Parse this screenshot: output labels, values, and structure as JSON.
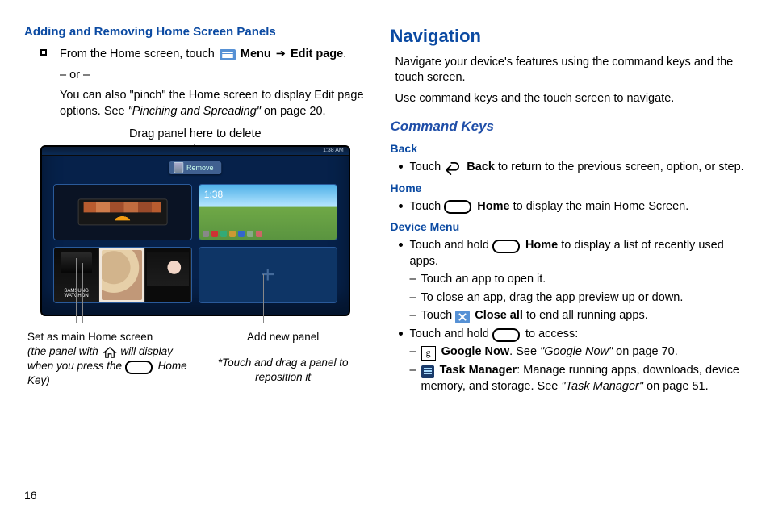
{
  "pageNumber": "16",
  "left": {
    "heading": "Adding and Removing Home Screen Panels",
    "bullet": {
      "pre": "From the Home screen, touch ",
      "menu": "Menu",
      "arrow": "➔",
      "editPage": "Edit page",
      "post": "."
    },
    "or": "– or –",
    "pinch1": "You can also \"pinch\" the Home screen to display Edit page options. See ",
    "pinchItal": "\"Pinching and Spreading\"",
    "pinch2": " on page 20.",
    "topCaption": "Drag panel here to delete",
    "removePill": "Remove",
    "statusTime": "1:38 AM",
    "panelClock": "1:38",
    "watchLabel": "SAMSUNG WATCHON",
    "botLeft1": "Set as main Home screen ",
    "botLeft2": "(the panel with ",
    "botLeft3": " will display when you press the ",
    "botLeft4": " Home Key)",
    "botRight1": "Add new panel",
    "botRight2": "*Touch and drag a panel to reposition it"
  },
  "right": {
    "h2": "Navigation",
    "p1": "Navigate your device's features using the command keys and the touch screen.",
    "p2": "Use command keys and the touch screen to navigate.",
    "h3": "Command Keys",
    "back": {
      "h": "Back",
      "pre": "Touch ",
      "bold": "Back",
      "post": " to return to the previous screen, option, or step."
    },
    "home": {
      "h": "Home",
      "pre": "Touch ",
      "bold": "Home",
      "post": " to display the main Home Screen."
    },
    "device": {
      "h": "Device Menu",
      "b1pre": "Touch and hold ",
      "b1bold": "Home",
      "b1post": " to display a list of recently used apps.",
      "s1": "Touch an app to open it.",
      "s2": "To close an app, drag the app preview up or down.",
      "s3pre": "Touch ",
      "s3bold": "Close all",
      "s3post": " to end all running apps.",
      "b2pre": "Touch and hold ",
      "b2post": " to access:",
      "s4bold": "Google Now",
      "s4mid": ". See ",
      "s4ital": "\"Google Now\"",
      "s4post": " on page 70.",
      "s5bold": "Task Manager",
      "s5mid": ": Manage running apps, downloads, device memory, and storage. See ",
      "s5ital": "\"Task Manager\"",
      "s5post": " on page 51."
    }
  }
}
